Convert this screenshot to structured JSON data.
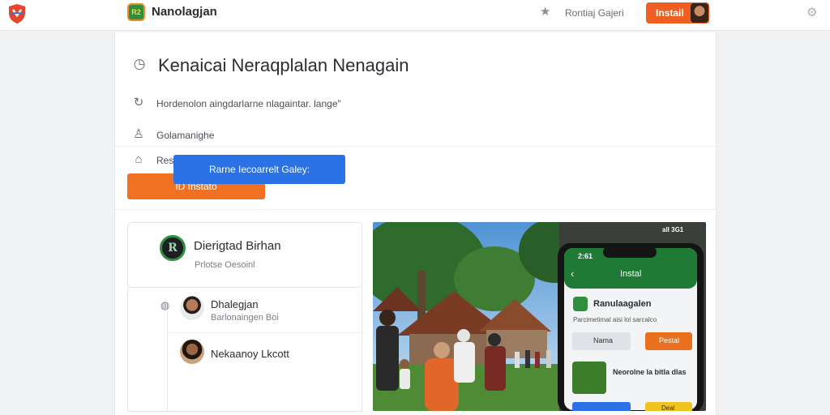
{
  "topbar": {
    "app_title": "Nanolagjan",
    "app_icon_text": "R2",
    "link": "Rontiaj Gajeri",
    "install_label": "Instail"
  },
  "main": {
    "title": "Kenaicai Neraqplalan Nenagain",
    "description": "Hordenolon aingdarlarne nlagaintar. lange\"",
    "developer": "Golamanighe",
    "category": "Restal",
    "install_button": "ID Instatö"
  },
  "developer_card": {
    "logo_text": "R",
    "name": "Dierigtad Birhan",
    "subtitle": "Prlotse Oesoinl"
  },
  "people": [
    {
      "name": "Dhalegjan",
      "subtitle": "Barlonaingen Boi"
    },
    {
      "name": "Nekaanoy Lkcott",
      "subtitle": ""
    }
  ],
  "action_button": "Rarne Iecoarrelt Galey:",
  "phone": {
    "status": "2:61",
    "status_right": "all 3G1",
    "header_title": "Instal",
    "app_name": "Ranulaagalen",
    "app_desc": "Parcimetimat aisi lol sarcalco",
    "btn_left": "Nama",
    "btn_right": "Pestal",
    "promo_text": "Neorolne la bitla dlas",
    "promo_btn_right": "Deal"
  },
  "colors": {
    "accent_orange": "#ef5f22",
    "install_orange": "#f07121",
    "blue": "#2a72e6",
    "brand_green": "#2f8f3e"
  },
  "icons": [
    "brand-logo-icon",
    "star-icon",
    "gear-icon",
    "clock-icon",
    "refresh-icon",
    "person-icon",
    "home-icon",
    "globe-icon"
  ]
}
